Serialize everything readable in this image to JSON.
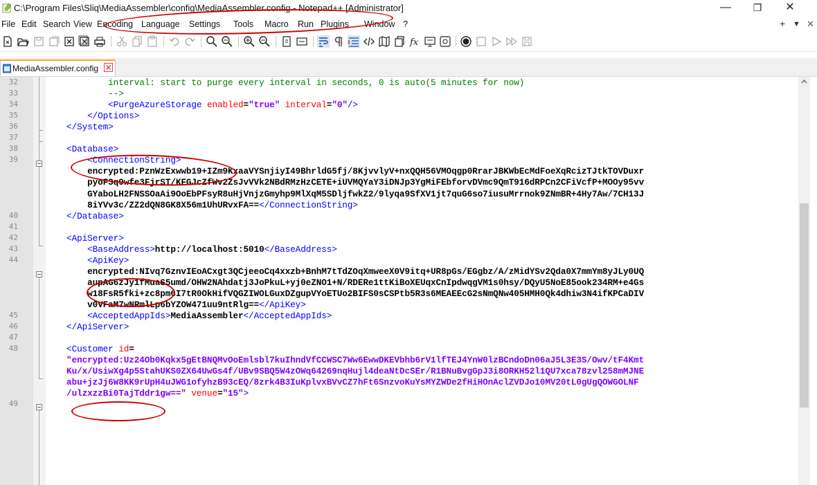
{
  "window": {
    "title": "C:\\Program Files\\Sliq\\MediaAssembler\\config\\MediaAssembler.config - Notepad++ [Administrator]",
    "minimize": "—",
    "maximize": "❐",
    "close": "✕"
  },
  "menu": {
    "items": [
      "File",
      "Edit",
      "Search",
      "View",
      "Encoding",
      "Language",
      "Settings",
      "Tools",
      "Macro",
      "Run",
      "Plugins",
      "Window",
      "?"
    ],
    "plus": "+",
    "dropdown": "▼",
    "close": "✕"
  },
  "tab": {
    "label": "MediaAssembler.config"
  },
  "lines": [
    {
      "num": "32",
      "parts": [
        {
          "t": "            interval: start to purge every interval in seconds, 0 is auto(5 minutes for now)",
          "c": "cm"
        }
      ]
    },
    {
      "num": "33",
      "parts": [
        {
          "t": "            -->",
          "c": "cm"
        }
      ]
    },
    {
      "num": "34",
      "parts": [
        {
          "t": "            <PurgeAzureStorage ",
          "c": "tg"
        },
        {
          "t": "enabled",
          "c": "at"
        },
        {
          "t": "=",
          "c": "tx"
        },
        {
          "t": "\"true\" ",
          "c": "av"
        },
        {
          "t": "interval",
          "c": "at"
        },
        {
          "t": "=",
          "c": "tx"
        },
        {
          "t": "\"0\"",
          "c": "av"
        },
        {
          "t": "/>",
          "c": "tg"
        }
      ]
    },
    {
      "num": "35",
      "parts": [
        {
          "t": "        </Options>",
          "c": "tg"
        }
      ]
    },
    {
      "num": "36",
      "parts": [
        {
          "t": "    </System>",
          "c": "tg"
        }
      ]
    },
    {
      "num": "37",
      "parts": []
    },
    {
      "num": "38",
      "parts": [
        {
          "t": "    <Database>",
          "c": "tg"
        }
      ]
    },
    {
      "num": "39",
      "parts": [
        {
          "t": "        <ConnectionString>",
          "c": "tg"
        }
      ]
    },
    {
      "num": "",
      "parts": [
        {
          "t": "        encrypted:PznWzExwwb19+IZm9KxaaVYSnjiyI49BhrldG5fj/8KjvvlyV+nxQQH56VMOqgp0RrarJBKWbEcMdFoeXqRcizTJtkTOVDuxr",
          "c": "tx"
        }
      ]
    },
    {
      "num": "",
      "parts": [
        {
          "t": "        pyoF3q9wfe3FjrST/KFGJcZfWv2ZsJvVVk2NBdRMzHzCETE+iUVMQYaY3iDNJp3YgMiFEbforvDVmc9QmT916dRPCn2CFiVcfP+MOOy95vv",
          "c": "tx"
        }
      ]
    },
    {
      "num": "",
      "parts": [
        {
          "t": "        GYaboLH2FNSSOaAi9OoEbPFsyR8uHjVnjzGmyhp9MlXqM5SDljfwkZ2/9lyqa9SfXV1jt7quG6so7iusuMrrnok9ZNmBR+4Hy7Aw/7CH13J",
          "c": "tx"
        }
      ]
    },
    {
      "num": "",
      "parts": [
        {
          "t": "        8iYVv3c/ZZ2dQN8GK8X56m1UhURvxFA==",
          "c": "tx"
        },
        {
          "t": "</ConnectionString>",
          "c": "tg"
        }
      ]
    },
    {
      "num": "40",
      "parts": [
        {
          "t": "    </Database>",
          "c": "tg"
        }
      ]
    },
    {
      "num": "41",
      "parts": []
    },
    {
      "num": "42",
      "parts": [
        {
          "t": "    <ApiServer>",
          "c": "tg"
        }
      ]
    },
    {
      "num": "43",
      "parts": [
        {
          "t": "        <BaseAddress>",
          "c": "tg"
        },
        {
          "t": "http://localhost:5010",
          "c": "tx"
        },
        {
          "t": "</BaseAddress>",
          "c": "tg"
        }
      ]
    },
    {
      "num": "44",
      "parts": [
        {
          "t": "        <ApiKey>",
          "c": "tg"
        }
      ]
    },
    {
      "num": "",
      "parts": [
        {
          "t": "        encrypted:NIvq7GznvIEoACxgt3QCjeeoCq4xxzb+BnhM7tTdZOqXmweeX0V9itq+UR8pGs/EGgbz/A/zMidYSv2Qda0X7mmYm8yJLy0UQ",
          "c": "tx"
        }
      ]
    },
    {
      "num": "",
      "parts": [
        {
          "t": "        aupAG6zJy1fMuaS5umd/OHW2NAhdatj3JoPkuL+yj0eZNO1+N/RDERe1ttKiBoXEUqxCnIpdwqgVM1s0hsy/DQyU5NoE85ook234RM+e4Gs",
          "c": "tx"
        }
      ]
    },
    {
      "num": "",
      "parts": [
        {
          "t": "        w18FsR5fki+zc8pm6I7tR0OkHifVQGZIWOLGuxDZgupVYoETUo2BIFS0sCSPtb5R3s6MEAEEcG2sNmQNw405HMH0Qk4dhiw3N4ifKPCaDIV",
          "c": "tx"
        }
      ]
    },
    {
      "num": "",
      "parts": [
        {
          "t": "        v0VFaM7wNRmlLp6bYZOW471uu9ntRlg==",
          "c": "tx"
        },
        {
          "t": "</ApiKey>",
          "c": "tg"
        }
      ]
    },
    {
      "num": "45",
      "parts": [
        {
          "t": "        <AcceptedAppIds>",
          "c": "tg"
        },
        {
          "t": "MediaAssembler",
          "c": "tx"
        },
        {
          "t": "</AcceptedAppIds>",
          "c": "tg"
        }
      ]
    },
    {
      "num": "46",
      "parts": [
        {
          "t": "    </ApiServer>",
          "c": "tg"
        }
      ]
    },
    {
      "num": "47",
      "parts": []
    },
    {
      "num": "48",
      "parts": [
        {
          "t": "    <Customer ",
          "c": "tg"
        },
        {
          "t": "id",
          "c": "at"
        },
        {
          "t": "=",
          "c": "tx"
        }
      ]
    },
    {
      "num": "",
      "parts": [
        {
          "t": "    \"encrypted:Uz24Ob0Kqkx5gEtBNQMvOoEmlsbl7kuIhndVfCCWSC7Ww6EwwDKEVbhb6rV1lfTEJ4YnW0lzBCndoDn06aJ5L3E3S/Owv/tF4Kmt",
          "c": "av"
        }
      ]
    },
    {
      "num": "",
      "parts": [
        {
          "t": "    Ku/x/UsiwXg4p5StahUKS0ZX64UwGs4f/UBv9SBQ5W4zOWq64269nqHujl4deaNtDcSEr/R1BNuBvgGpJ3i8ORKH52l1QU7xca78zvl258mMJNE",
          "c": "av"
        }
      ]
    },
    {
      "num": "",
      "parts": [
        {
          "t": "    abu+jzJj6W8KK9rUpH4uJWG1ofyhzB93cEQ/8zrk4B3IuKplvxBVvCZ7hFt6SnzvoKuYsMYZWDe2fHiHOnAclZVDJo10MV20tL0gUgQOWGOLNF",
          "c": "av"
        }
      ]
    },
    {
      "num": "",
      "parts": [
        {
          "t": "    /ulzxzzBi0TajTddr1gw==\" ",
          "c": "av"
        },
        {
          "t": "venue",
          "c": "at"
        },
        {
          "t": "=",
          "c": "tx"
        },
        {
          "t": "\"15\"",
          "c": "av"
        },
        {
          "t": ">",
          "c": "tg"
        }
      ]
    },
    {
      "num": "49",
      "parts": []
    }
  ]
}
